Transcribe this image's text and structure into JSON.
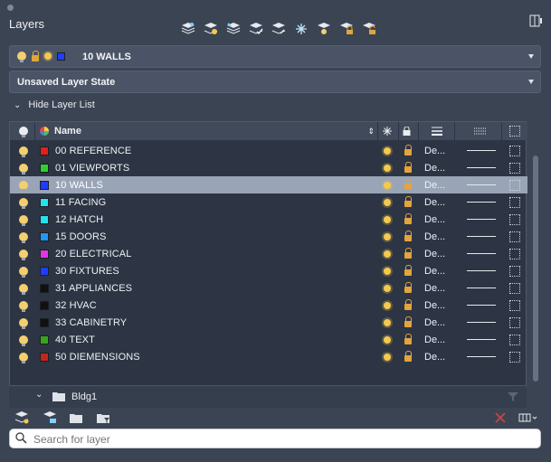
{
  "panel": {
    "title": "Layers",
    "current_layer": {
      "name": "10 WALLS",
      "color": "#1f3cff"
    },
    "layer_state": "Unsaved Layer State",
    "hide_link": "Hide Layer List"
  },
  "toolbar": {
    "icons": [
      "new-layer-icon",
      "new-layer-vp-frozen-icon",
      "delete-layer-icon",
      "set-current-icon",
      "match-layer-icon",
      "freeze-icon",
      "isolate-icon",
      "lock-icon",
      "unlock-icon"
    ]
  },
  "columns": {
    "name": "Name",
    "on": "bulb-icon",
    "color": "color-wheel-icon",
    "freeze": "snowflake-icon",
    "lock": "lock-icon",
    "linetype": "linetype-icon",
    "lineweight": "lineweight-icon",
    "transparency": "transparency-icon"
  },
  "layers": [
    {
      "name": "00 REFERENCE",
      "color": "#e0201b",
      "linetype": "De..."
    },
    {
      "name": "01 VIEWPORTS",
      "color": "#2fd12f",
      "linetype": "De..."
    },
    {
      "name": "10 WALLS",
      "color": "#1f3cff",
      "linetype": "De...",
      "selected": true
    },
    {
      "name": "11 FACING",
      "color": "#23e3ee",
      "linetype": "De..."
    },
    {
      "name": "12 HATCH",
      "color": "#23e3ee",
      "linetype": "De..."
    },
    {
      "name": "15 DOORS",
      "color": "#2196f3",
      "linetype": "De..."
    },
    {
      "name": "20 ELECTRICAL",
      "color": "#e036e6",
      "linetype": "De..."
    },
    {
      "name": "30 FIXTURES",
      "color": "#1f3cff",
      "linetype": "De..."
    },
    {
      "name": "31 APPLIANCES",
      "color": "#111111",
      "linetype": "De..."
    },
    {
      "name": "32 HVAC",
      "color": "#111111",
      "linetype": "De..."
    },
    {
      "name": "33 CABINETRY",
      "color": "#111111",
      "linetype": "De..."
    },
    {
      "name": "40 TEXT",
      "color": "#36a61d",
      "linetype": "De..."
    },
    {
      "name": "50 DIEMENSIONS",
      "color": "#c1261b",
      "linetype": "De..."
    }
  ],
  "group": {
    "name": "Bldg1"
  },
  "bottom_bar": {
    "icons": [
      "new-layer-group-icon",
      "new-filter-icon",
      "folder-icon",
      "layer-properties-filter-icon",
      "delete-red-x-icon",
      "columns-icon"
    ]
  },
  "search": {
    "placeholder": "Search for layer",
    "value": ""
  }
}
